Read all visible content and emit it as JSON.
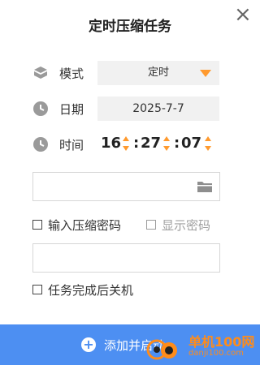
{
  "dialog": {
    "title": "定时压缩任务",
    "close_icon": "close-icon"
  },
  "mode": {
    "label": "模式",
    "value": "定时",
    "icon": "cube-icon"
  },
  "date": {
    "label": "日期",
    "value": "2025-7-7",
    "icon": "clock-icon"
  },
  "time": {
    "label": "时间",
    "hour": "16",
    "minute": "27",
    "second": "07",
    "sep": ":",
    "icon": "clock-icon"
  },
  "path_input": {
    "value": "",
    "placeholder": ""
  },
  "password": {
    "checkbox_label": "输入压缩密码",
    "show_label": "显示密码",
    "value": ""
  },
  "shutdown": {
    "checkbox_label": "任务完成后关机"
  },
  "footer": {
    "button_label": "添加并启动"
  },
  "watermark": {
    "name": "单机100网",
    "url": "danji100.com"
  },
  "colors": {
    "accent": "#ff9a2e",
    "primary": "#4d8ff2"
  }
}
